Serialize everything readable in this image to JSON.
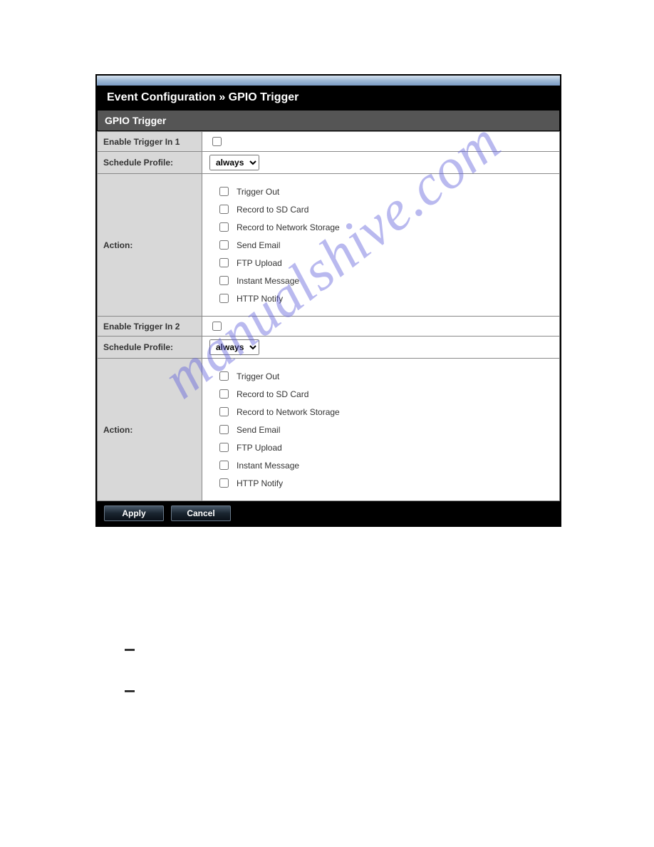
{
  "breadcrumb": "Event Configuration » GPIO Trigger",
  "section_title": "GPIO Trigger",
  "labels": {
    "enable1": "Enable Trigger In 1",
    "enable2": "Enable Trigger In 2",
    "schedule": "Schedule Profile:",
    "action": "Action:"
  },
  "schedule_value": "always",
  "actions": [
    "Trigger Out",
    "Record to SD Card",
    "Record to Network Storage",
    "Send Email",
    "FTP Upload",
    "Instant Message",
    "HTTP Notify"
  ],
  "buttons": {
    "apply": "Apply",
    "cancel": "Cancel"
  },
  "watermark": "manualshive.com"
}
